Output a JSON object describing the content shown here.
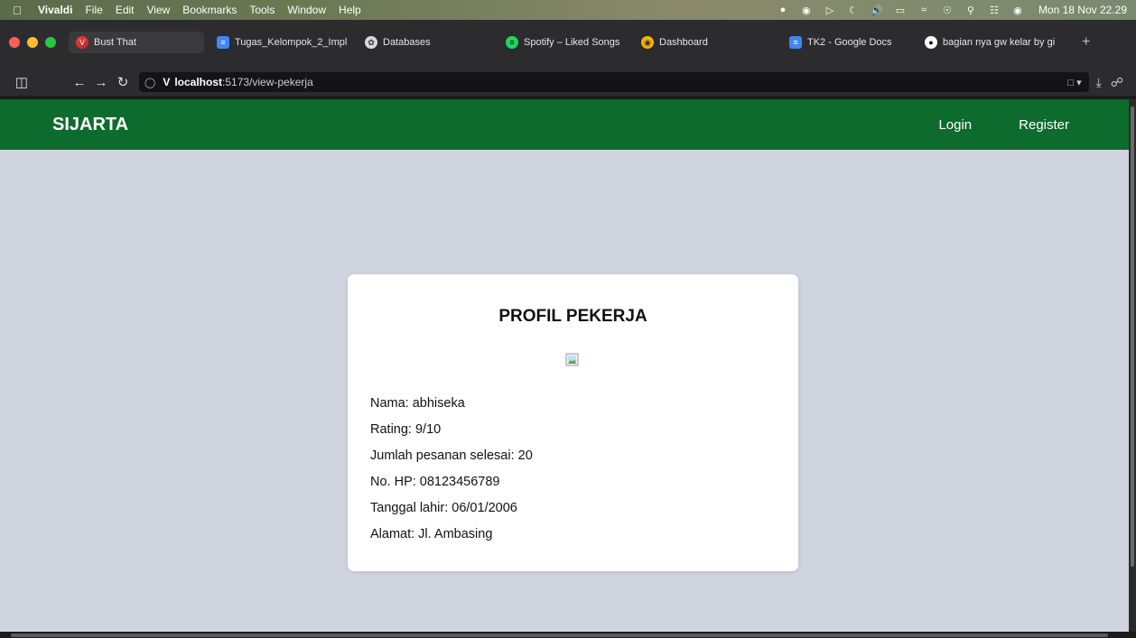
{
  "menubar": {
    "app_name": "Vivaldi",
    "items": [
      "File",
      "Edit",
      "View",
      "Bookmarks",
      "Tools",
      "Window",
      "Help"
    ],
    "clock": "Mon 18 Nov 22.29"
  },
  "tabs": [
    {
      "label": "Bust That",
      "icon": "vivaldi-icon",
      "active": true
    },
    {
      "label": "Tugas_Kelompok_2_Impl",
      "icon": "google-docs-icon"
    },
    {
      "label": "Databases",
      "icon": "openai-icon"
    },
    {
      "label": "Spotify – Liked Songs",
      "icon": "spotify-icon"
    },
    {
      "label": "Dashboard",
      "icon": "dashboard-icon"
    },
    {
      "label": "TK2 - Google Docs",
      "icon": "google-docs-icon"
    },
    {
      "label": "bagian nya gw kelar by gi",
      "icon": "github-icon"
    }
  ],
  "address": {
    "host": "localhost",
    "path": ":5173/view-pekerja"
  },
  "site": {
    "brand": "SIJARTA",
    "nav": {
      "login": "Login",
      "register": "Register"
    },
    "brand_color": "#0d6b2e",
    "background": "#cfd4de"
  },
  "profile": {
    "title": "PROFIL PEKERJA",
    "nama": "Nama: abhiseka",
    "rating": "Rating: 9/10",
    "jumlah_pesanan": "Jumlah pesanan selesai: 20",
    "no_hp": "No. HP: 08123456789",
    "tanggal_lahir": "Tanggal lahir: 06/01/2006",
    "alamat": "Alamat: Jl. Ambasing"
  }
}
